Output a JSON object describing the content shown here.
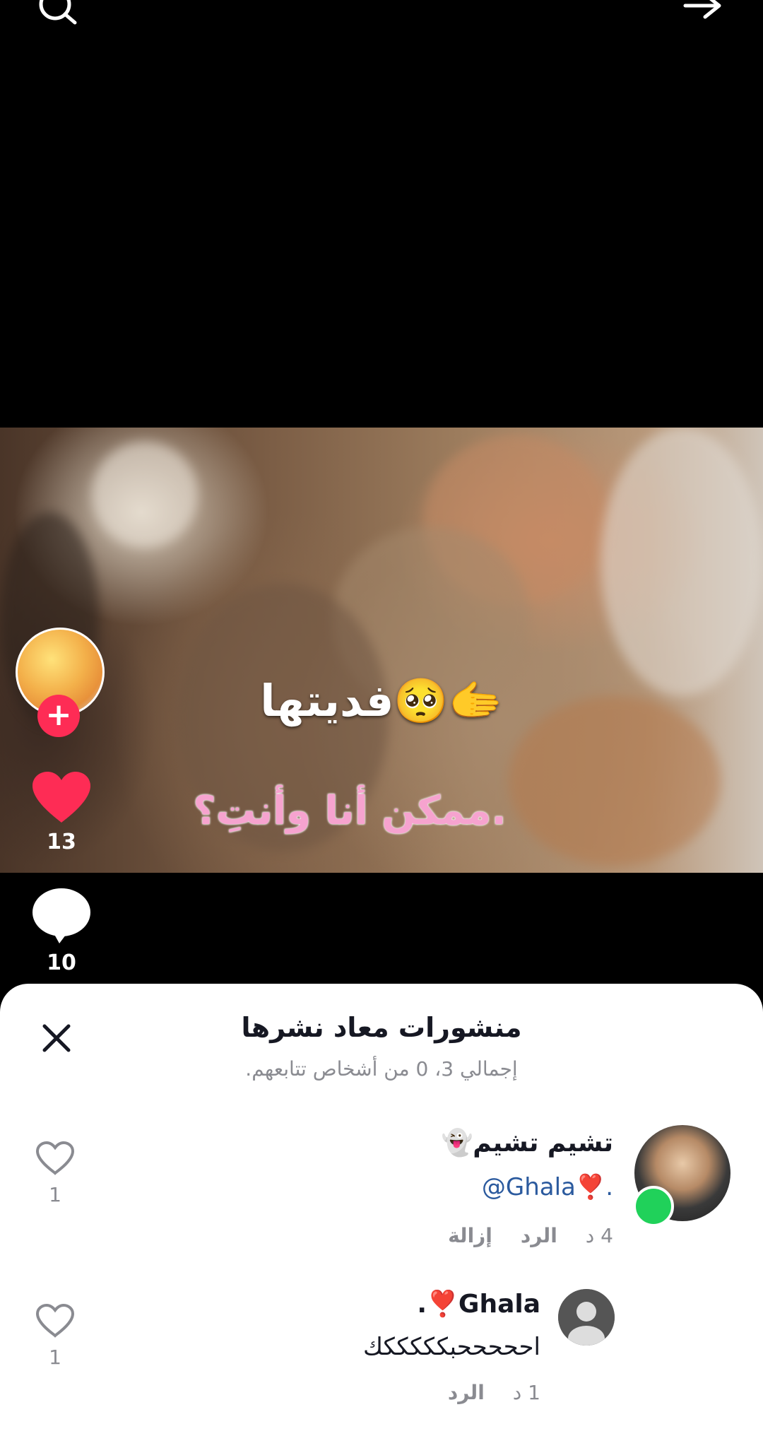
{
  "overlay": {
    "caption_line1": "فديتها🥺🫱",
    "caption_line2": "ممكن أنا وأنتِ؟."
  },
  "rail": {
    "like_count": "13",
    "comment_count": "10"
  },
  "sheet": {
    "title": "منشورات معاد نشرها",
    "subtitle": "إجمالي 3، 0 من أشخاص تتابعهم."
  },
  "comments": [
    {
      "name": "تشيم تشيم👻",
      "text": "@Ghala❣️.",
      "time": "4 د",
      "reply": "الرد",
      "remove": "إزالة",
      "likes": "1"
    },
    {
      "name": "Ghala❣️.",
      "text": "احححححبكككككك",
      "time": "1 د",
      "reply": "الرد",
      "likes": "1"
    }
  ],
  "colors": {
    "accent": "#fe2c55",
    "mention": "#2b5a9e",
    "online": "#20d15a"
  }
}
